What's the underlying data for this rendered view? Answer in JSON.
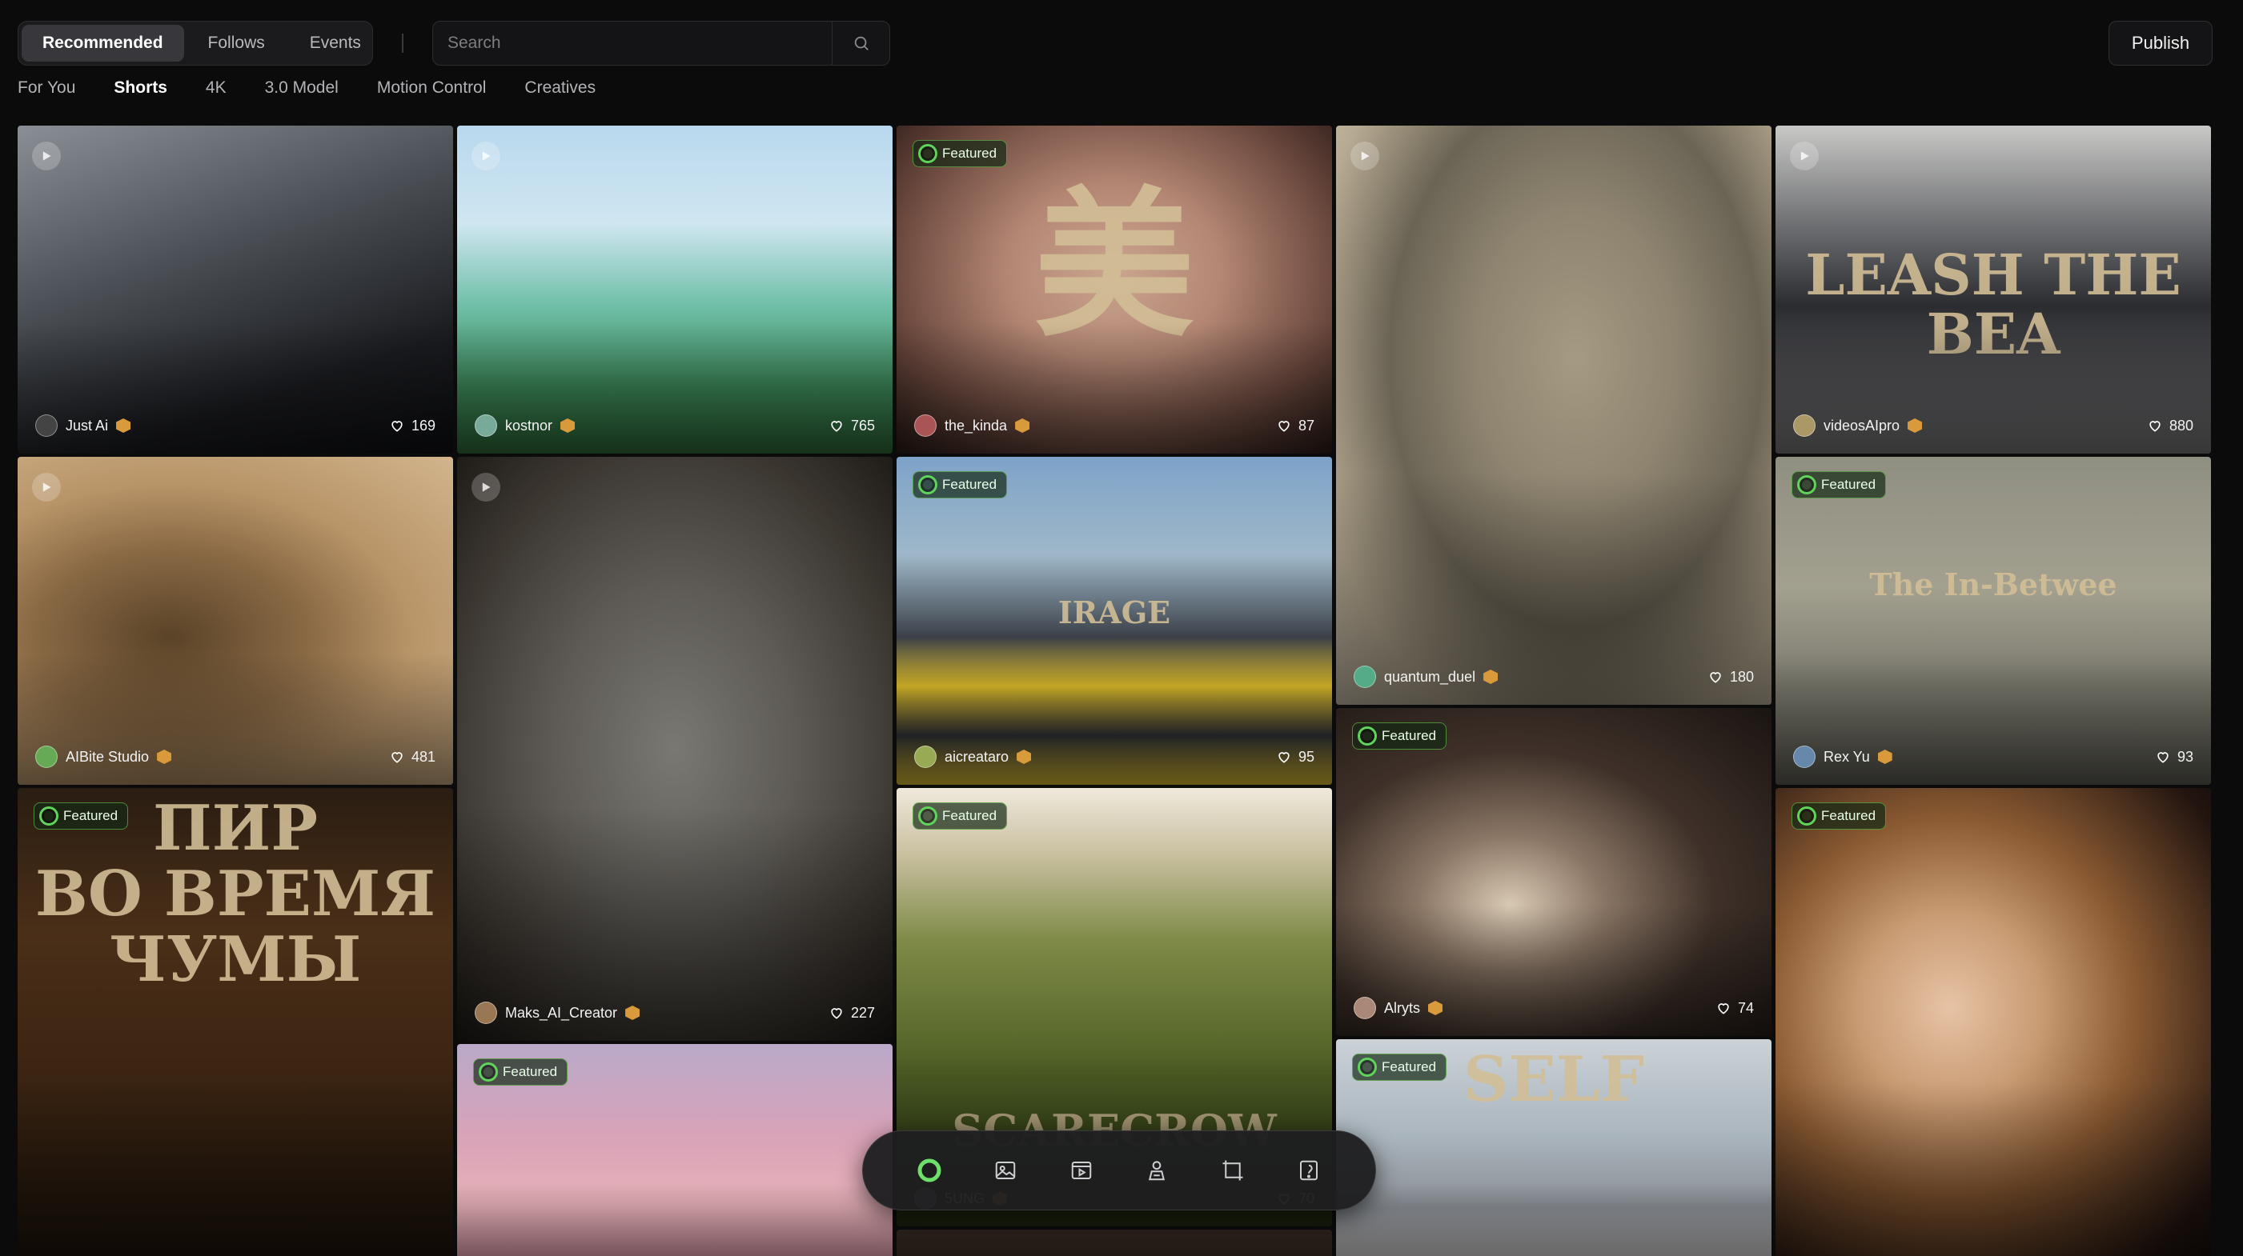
{
  "header": {
    "segments": [
      {
        "label": "Recommended",
        "active": true
      },
      {
        "label": "Follows",
        "active": false
      },
      {
        "label": "Events",
        "active": false
      }
    ],
    "search_placeholder": "Search",
    "publish_label": "Publish"
  },
  "subtabs": [
    {
      "label": "For You",
      "active": false
    },
    {
      "label": "Shorts",
      "active": true
    },
    {
      "label": "4K",
      "active": false
    },
    {
      "label": "3.0 Model",
      "active": false
    },
    {
      "label": "Motion Control",
      "active": false
    },
    {
      "label": "Creatives",
      "active": false
    }
  ],
  "featured_label": "Featured",
  "cards": [
    {
      "author": "Just Ai",
      "likes": "169",
      "featured": false,
      "play": true,
      "text": ""
    },
    {
      "author": "AIBite Studio",
      "likes": "481",
      "featured": false,
      "play": true,
      "text": ""
    },
    {
      "author": "",
      "likes": "",
      "featured": true,
      "play": false,
      "text": "ПИР\nВО ВРЕМЯ ЧУМЫ"
    },
    {
      "author": "kostnor",
      "likes": "765",
      "featured": false,
      "play": true,
      "text": ""
    },
    {
      "author": "Maks_AI_Creator",
      "likes": "227",
      "featured": false,
      "play": true,
      "text": ""
    },
    {
      "author": "",
      "likes": "",
      "featured": true,
      "play": false,
      "text": ""
    },
    {
      "author": "the_kinda",
      "likes": "87",
      "featured": true,
      "play": false,
      "text": "美"
    },
    {
      "author": "aicreataro",
      "likes": "95",
      "featured": true,
      "play": false,
      "text": "IRAGE"
    },
    {
      "author": "5UNG",
      "likes": "70",
      "featured": true,
      "play": false,
      "text": "SCARECROW"
    },
    {
      "author": "",
      "likes": "",
      "featured": false,
      "play": false,
      "text": ""
    },
    {
      "author": "quantum_duel",
      "likes": "180",
      "featured": false,
      "play": true,
      "text": ""
    },
    {
      "author": "Alryts",
      "likes": "74",
      "featured": true,
      "play": false,
      "text": ""
    },
    {
      "author": "",
      "likes": "",
      "featured": true,
      "play": false,
      "text": "SELF"
    },
    {
      "author": "videosAIpro",
      "likes": "880",
      "featured": false,
      "play": true,
      "text": "LEASH    THE BEA"
    },
    {
      "author": "Rex Yu",
      "likes": "93",
      "featured": true,
      "play": false,
      "text": "The In-Betwee"
    },
    {
      "author": "",
      "likes": "",
      "featured": true,
      "play": false,
      "text": ""
    }
  ],
  "dock": [
    {
      "icon": "logo-icon"
    },
    {
      "icon": "image-icon"
    },
    {
      "icon": "video-icon"
    },
    {
      "icon": "avatar-icon"
    },
    {
      "icon": "canvas-icon"
    },
    {
      "icon": "assets-icon"
    }
  ],
  "colors": {
    "background": "#0b0b0c",
    "featured_accent": "#5fd35a",
    "badge": "#d89a3a"
  }
}
